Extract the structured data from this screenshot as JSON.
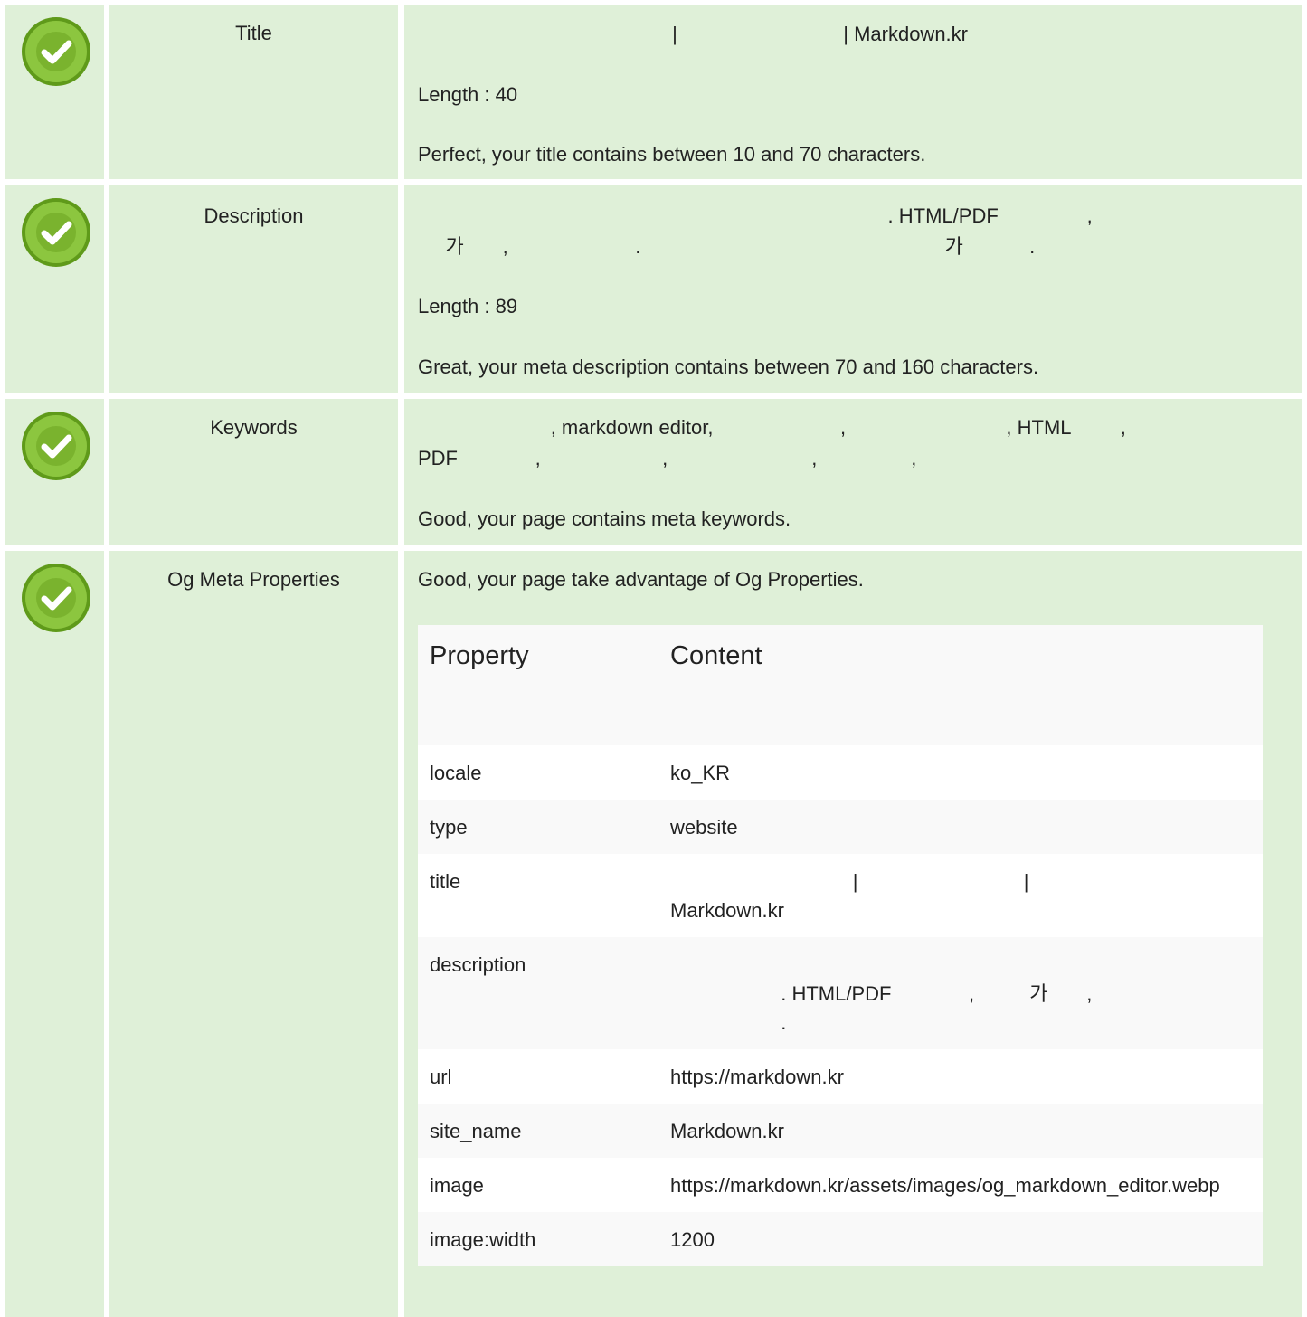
{
  "rows": {
    "title": {
      "label": "Title",
      "value_line": "                                              |                              | Markdown.kr",
      "length": "Length : 40",
      "message": "Perfect, your title contains between 10 and 70 characters."
    },
    "description": {
      "label": "Description",
      "value_line1": "                                                                                     . HTML/PDF                ,",
      "value_line2": "     가       ,                       .                                                       가            .",
      "length": "Length : 89",
      "message": "Great, your meta description contains between 70 and 160 characters."
    },
    "keywords": {
      "label": "Keywords",
      "value_line1": "                        , markdown editor,                       ,                             , HTML         ,",
      "value_line2": "PDF              ,                      ,                          ,                 ,",
      "message": "Good, your page contains meta keywords."
    },
    "og": {
      "label": "Og Meta Properties",
      "message": "Good, your page take advantage of Og Properties.",
      "table": {
        "header_property": "Property",
        "header_content": "Content",
        "rows": [
          {
            "property": "locale",
            "content": "ko_KR"
          },
          {
            "property": "type",
            "content": "website"
          },
          {
            "property": "title",
            "content": "                                 |                              |\nMarkdown.kr"
          },
          {
            "property": "description",
            "content": "\n                    . HTML/PDF              ,          가       ,\n                    ."
          },
          {
            "property": "url",
            "content": "https://markdown.kr"
          },
          {
            "property": "site_name",
            "content": "Markdown.kr"
          },
          {
            "property": "image",
            "content": "https://markdown.kr/assets/images/og_markdown_editor.webp"
          },
          {
            "property": "image:width",
            "content": "1200"
          }
        ]
      }
    }
  },
  "icons": {
    "status": "check-circle-icon",
    "color_outer": "#7ab800",
    "color_inner": "#8cc63f"
  }
}
